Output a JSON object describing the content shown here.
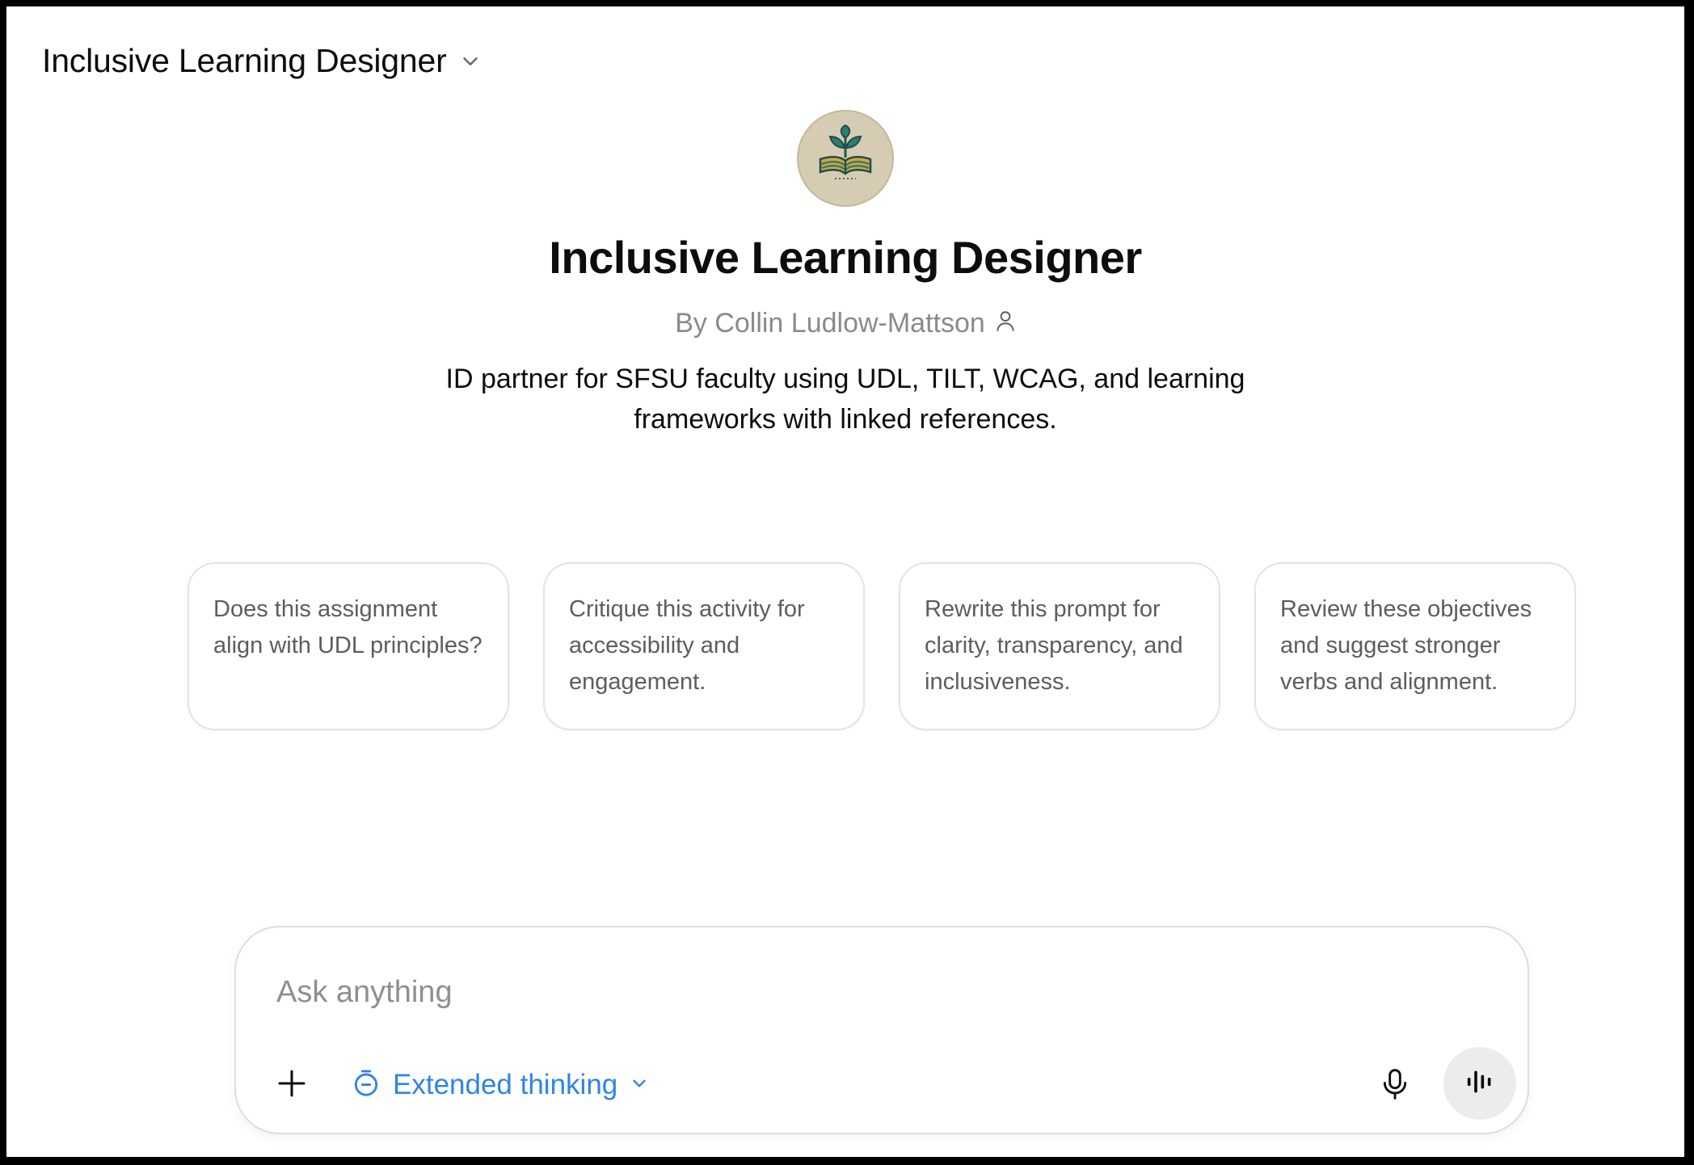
{
  "header": {
    "gpt_name": "Inclusive Learning Designer",
    "selector_icon": "chevron-down-icon"
  },
  "hero": {
    "avatar_icon": "sprout-book-logo",
    "title": "Inclusive Learning Designer",
    "author": "By Collin Ludlow-Mattson",
    "author_icon": "person-icon",
    "description": "ID partner for SFSU faculty using UDL, TILT, WCAG, and learning frameworks with linked references."
  },
  "starters": [
    {
      "label": "Does this assignment align with UDL principles?"
    },
    {
      "label": "Critique this activity for accessibility and engagement."
    },
    {
      "label": "Rewrite this prompt for clarity, transparency, and inclusiveness."
    },
    {
      "label": "Review these objectives and suggest stronger verbs and alignment."
    }
  ],
  "composer": {
    "placeholder": "Ask anything",
    "value": "",
    "add_icon": "plus-icon",
    "mode_label": "Extended thinking",
    "mode_icon": "timer-icon",
    "mode_chevron_icon": "chevron-down-icon",
    "mic_icon": "microphone-icon",
    "voice_icon": "voice-waveform-icon"
  },
  "colors": {
    "accent": "#2f84e8",
    "text": "#0d0d0d",
    "muted": "#8a8a8a",
    "avatar_bg": "#d6ccb3"
  }
}
